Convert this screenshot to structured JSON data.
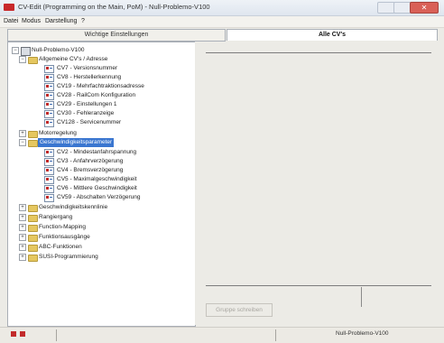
{
  "window": {
    "title": "CV-Edit (Programming on the Main, PoM) - Null-Problemo-V100"
  },
  "menu": [
    "Datei",
    "Modus",
    "Darstellung",
    "?"
  ],
  "tabs": {
    "left": "Wichtige Einstellungen",
    "right": "Alle CV's"
  },
  "tree": {
    "root": "Null-Problemo-V100",
    "items": [
      {
        "label": "Allgemeine CV's / Adresse",
        "type": "folder"
      },
      {
        "label": "CV7 - Versionsnummer",
        "type": "cv"
      },
      {
        "label": "CV8 - Herstellerkennung",
        "type": "cv"
      },
      {
        "label": "CV19 - Mehrfachtraktionsadresse",
        "type": "cv"
      },
      {
        "label": "CV28 - RailCom Konfiguration",
        "type": "cv"
      },
      {
        "label": "CV29 - Einstellungen 1",
        "type": "cv"
      },
      {
        "label": "CV30 - Fehleranzeige",
        "type": "cv"
      },
      {
        "label": "CV128 - Servicenummer",
        "type": "cv"
      },
      {
        "label": "Motorregelung",
        "type": "folder"
      },
      {
        "label": "Geschwindigkeitsparameter",
        "type": "folder",
        "selected": true
      },
      {
        "label": "CV2 - Mindestanfahrspannung",
        "type": "cv"
      },
      {
        "label": "CV3 - Anfahrverzögerung",
        "type": "cv"
      },
      {
        "label": "CV4 - Bremsverzögerung",
        "type": "cv"
      },
      {
        "label": "CV5 - Maximalgeschwindigkeit",
        "type": "cv"
      },
      {
        "label": "CV6 - Mittlere Geschwindigkeit",
        "type": "cv"
      },
      {
        "label": "CV59 - Abschalten Verzögerung",
        "type": "cv"
      },
      {
        "label": "Geschwindigkeitskennlinie",
        "type": "folder"
      },
      {
        "label": "Rangiergang",
        "type": "folder"
      },
      {
        "label": "Function-Mapping",
        "type": "folder"
      },
      {
        "label": "Funktionsausgänge",
        "type": "folder"
      },
      {
        "label": "ABC-Funktionen",
        "type": "folder"
      },
      {
        "label": "SUSI-Programmierung",
        "type": "folder"
      }
    ]
  },
  "buttons": {
    "write_group": "Gruppe schreiben"
  },
  "status": {
    "decoder": "Null-Problemo-V100"
  },
  "colors": {
    "accent": "#3a76d0",
    "status_red": "#c22b2b"
  }
}
